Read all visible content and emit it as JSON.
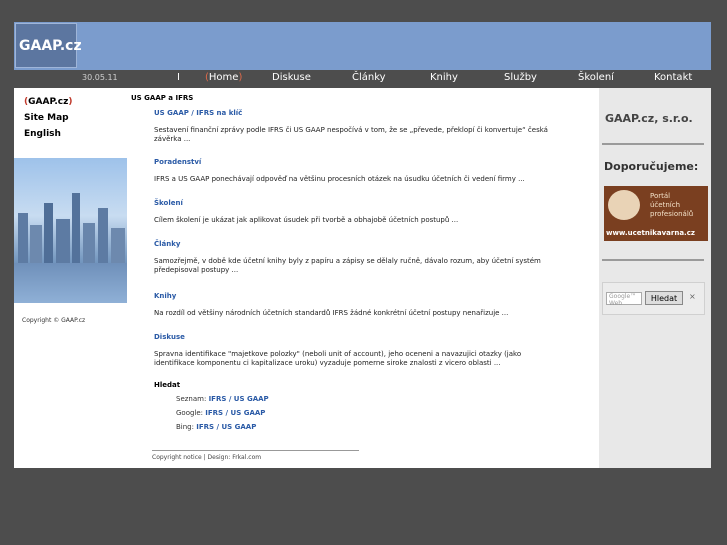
{
  "header": {
    "logo": "GAAP.cz"
  },
  "nav": {
    "date": "30.05.11",
    "separator": "I",
    "home_open": "(",
    "home": "Home",
    "home_close": ")",
    "items": [
      "Diskuse",
      "Články",
      "Knihy",
      "Služby",
      "Školení",
      "Kontakt"
    ]
  },
  "left": {
    "links": {
      "gaap_open": "(",
      "gaap": "GAAP.cz",
      "gaap_close": ")",
      "sitemap": "Site Map",
      "english": "English"
    },
    "copyright": "Copyright © GAAP.cz"
  },
  "main": {
    "crumb": "US GAAP a IFRS",
    "sections": [
      {
        "title": "US GAAP / IFRS na klíč",
        "text": "Sestavení finanční zprávy podle IFRS či US GAAP nespočívá v tom, že se „převede, překlopí či konvertuje“ česká závěrka ..."
      },
      {
        "title": "Poradenství",
        "text": "IFRS a US GAAP ponechávají odpověď na většinu procesních otázek na úsudku účetních či vedení firmy ..."
      },
      {
        "title": "Školení",
        "text": "Cílem školení je ukázat jak aplikovat úsudek při tvorbě a obhajobě účetních postupů ..."
      },
      {
        "title": "Články",
        "text": "Samozřejmě, v době kde účetní knihy byly z papíru a zápisy se dělaly ručně, dávalo rozum, aby účetní systém předepisoval postupy ..."
      },
      {
        "title": "Knihy",
        "text": "Na rozdíl od většiny národních účetních standardů IFRS žádné konkrétní účetní postupy nenařizuje ..."
      },
      {
        "title": "Diskuse",
        "text": "Spravna identifikace \"majetkove polozky\" (neboli unit of account), jeho oceneni a navazujici otazky (jako identifikace komponentu ci kapitalizace uroku) vyzaduje pomerne siroke znalosti z vicero oblasti ..."
      }
    ],
    "search": {
      "title": "Hledat",
      "rows": [
        {
          "label": "Seznam:",
          "link": "IFRS / US GAAP"
        },
        {
          "label": "Google:",
          "link": "IFRS / US GAAP"
        },
        {
          "label": "Bing:",
          "link": "IFRS / US GAAP"
        }
      ]
    },
    "copyright": "Copyright notice | Design: Frkal.com"
  },
  "right": {
    "title": "GAAP.cz, s.r.o.",
    "recommend": "Doporučujeme:",
    "banner": {
      "line1": "Portál",
      "line2": "účetních",
      "line3": "profesionálů",
      "url": "www.ucetnikavarna.cz"
    },
    "search_placeholder": "Google™ Web",
    "search_button": "Hledat",
    "close": "×"
  },
  "colors": {
    "header": "#7b9ccd",
    "logo_bg": "#5c76a0",
    "link": "#2a5aa6",
    "background": "#4d4d4d",
    "sidebar": "#e8e8e8",
    "banner": "#7a3f20"
  }
}
